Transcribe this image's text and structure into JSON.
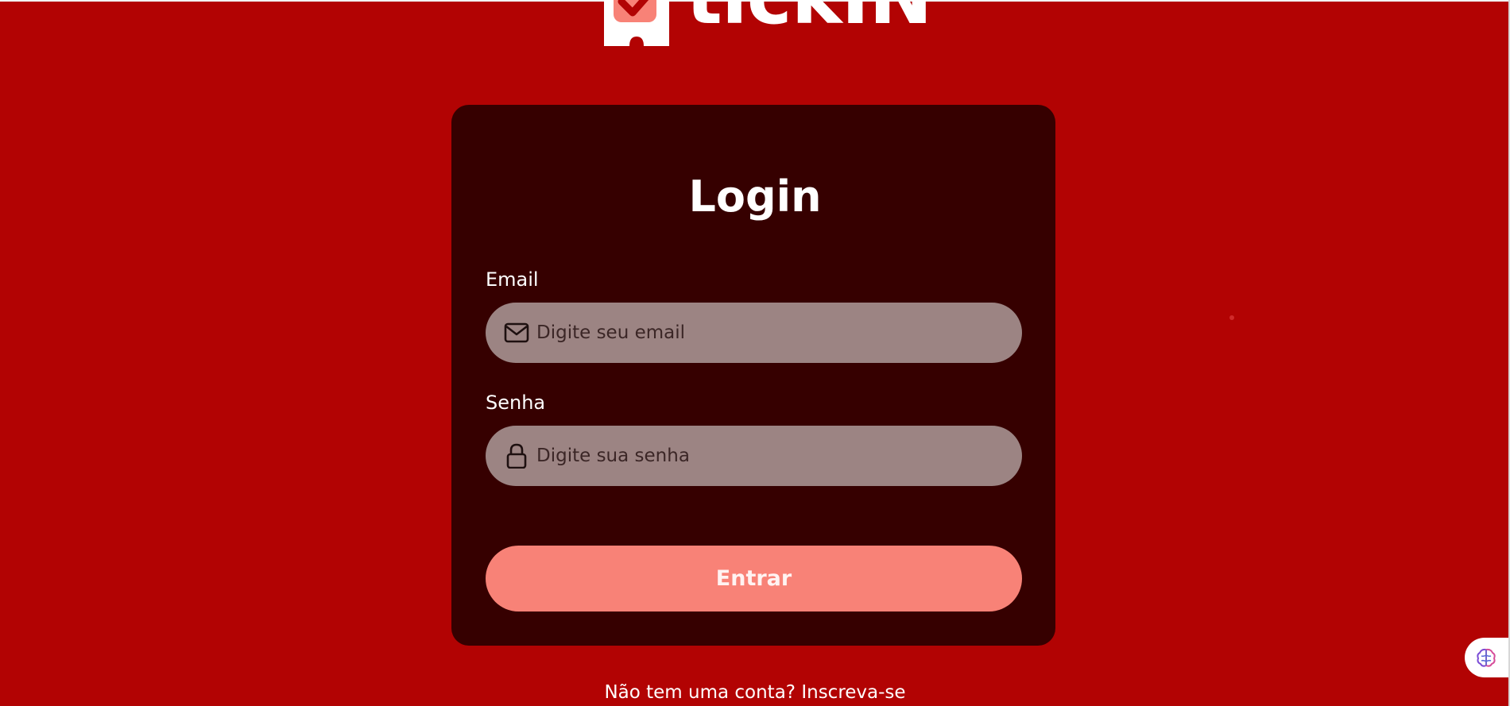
{
  "logo": {
    "text": "tickIN"
  },
  "login": {
    "title": "Login",
    "email_label": "Email",
    "email_placeholder": "Digite seu email",
    "password_label": "Senha",
    "password_placeholder": "Digite sua senha",
    "submit_label": "Entrar"
  },
  "signup": {
    "prompt": "Não tem uma conta?",
    "link": "Inscreva-se"
  },
  "icons": {
    "email": "mail-icon",
    "password": "lock-icon",
    "floating_widget": "brain-icon"
  },
  "colors": {
    "background": "#b20303",
    "card": "#360000",
    "input": "#9c8483",
    "button": "#f88277"
  }
}
